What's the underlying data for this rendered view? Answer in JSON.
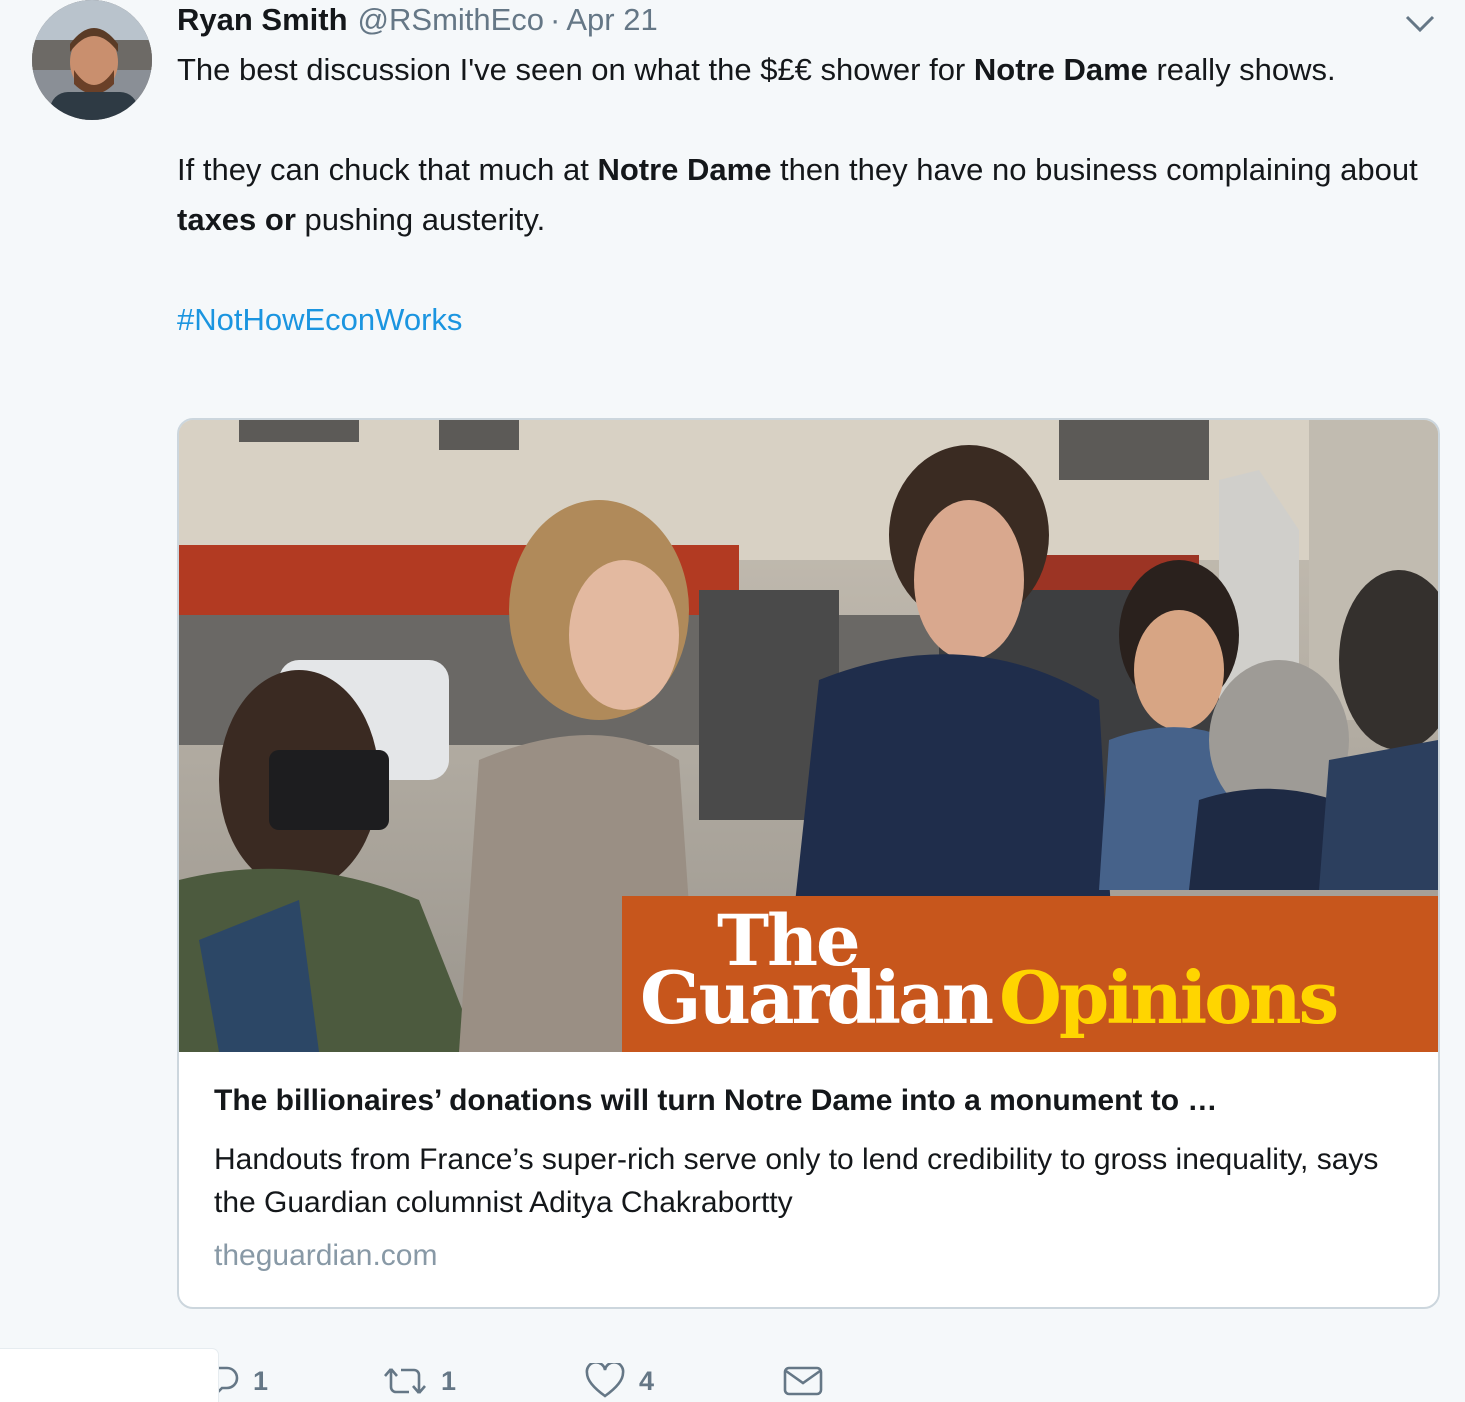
{
  "tweet": {
    "author_name": "Ryan Smith",
    "author_handle": "@RSmithEco",
    "separator": "·",
    "date": "Apr 21",
    "line1_a": "The best discussion I've seen on what the $£€ shower for ",
    "line1_bold": "Notre Dame",
    "line1_b": " really shows.",
    "line2_a": "If they can chuck that much at ",
    "line2_bold": "Notre Dame",
    "line2_b": " then they have no business complaining about ",
    "line2_bold2": "taxes or",
    "line2_c": " pushing austerity.",
    "hashtag": "#NotHowEconWorks"
  },
  "card": {
    "brand_the": "The",
    "brand_guardian": "Guardian",
    "brand_opinions": "Opinions",
    "title": "The billionaires’ donations will turn Notre Dame into a monument to …",
    "description": "Handouts from France’s super-rich serve only to lend credibility to gross inequality, says the Guardian columnist Aditya Chakrabortty",
    "domain": "theguardian.com"
  },
  "actions": {
    "reply_count": "1",
    "retweet_count": "1",
    "like_count": "4"
  },
  "colors": {
    "link": "#1b95e0",
    "muted": "#657786",
    "brand_orange": "#c7561c",
    "brand_yellow": "#ffd500"
  },
  "icons": [
    "chevron-down-icon",
    "reply-icon",
    "retweet-icon",
    "heart-icon",
    "envelope-icon"
  ]
}
